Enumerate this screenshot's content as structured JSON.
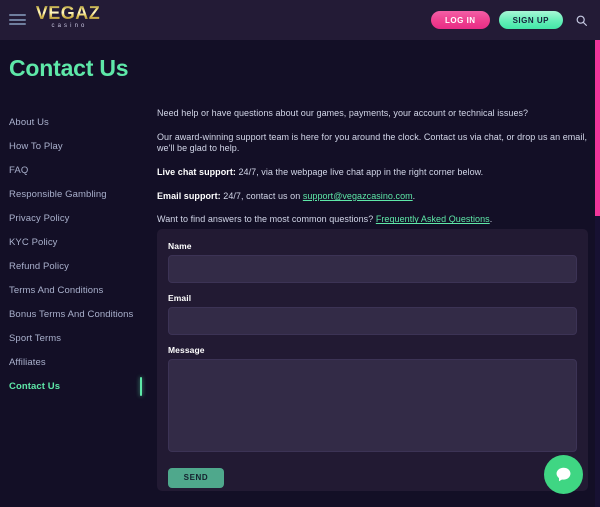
{
  "header": {
    "menu_icon": "hamburger-icon",
    "logo_brand": "VEGAZ",
    "logo_sub": "casino",
    "login_label": "LOG IN",
    "signup_label": "SIGN UP",
    "search_icon": "search-icon"
  },
  "page": {
    "title": "Contact Us"
  },
  "sidebar": {
    "items": [
      {
        "label": "About Us",
        "active": false
      },
      {
        "label": "How To Play",
        "active": false
      },
      {
        "label": "FAQ",
        "active": false
      },
      {
        "label": "Responsible Gambling",
        "active": false
      },
      {
        "label": "Privacy Policy",
        "active": false
      },
      {
        "label": "KYC Policy",
        "active": false
      },
      {
        "label": "Refund Policy",
        "active": false
      },
      {
        "label": "Terms And Conditions",
        "active": false
      },
      {
        "label": "Bonus Terms And Conditions",
        "active": false
      },
      {
        "label": "Sport Terms",
        "active": false
      },
      {
        "label": "Affiliates",
        "active": false
      },
      {
        "label": "Contact Us",
        "active": true
      }
    ]
  },
  "content": {
    "p1": "Need help or have questions about our games, payments, your account or technical issues?",
    "p2": "Our award-winning support team is here for you around the clock. Contact us via chat, or drop us an email, we'll be glad to help.",
    "p3_label": "Live chat support:",
    "p3_text": " 24/7, via the webpage live chat app in the right corner below.",
    "p4_label": "Email support:",
    "p4_text": " 24/7, contact us on ",
    "p4_link": "support@vegazcasino.com",
    "p4_tail": ".",
    "p5_text": "Want to find answers to the most common questions? ",
    "p5_link": "Frequently Asked Questions",
    "p5_tail": "."
  },
  "form": {
    "name_label": "Name",
    "name_value": "",
    "name_placeholder": "",
    "email_label": "Email",
    "email_value": "",
    "email_placeholder": "",
    "message_label": "Message",
    "message_value": "",
    "message_placeholder": "",
    "send_label": "SEND"
  },
  "chat": {
    "icon": "chat-bubble-icon"
  },
  "colors": {
    "accent_green": "#5ee8a8",
    "accent_pink": "#ef3f8f",
    "gold": "#e9cf63",
    "page_bg": "#130f26",
    "header_bg": "#231b36",
    "panel_bg": "#221a33",
    "input_bg": "#332b47",
    "scrollbar_thumb": "#f0369a",
    "chat_bg": "#3fd683"
  }
}
